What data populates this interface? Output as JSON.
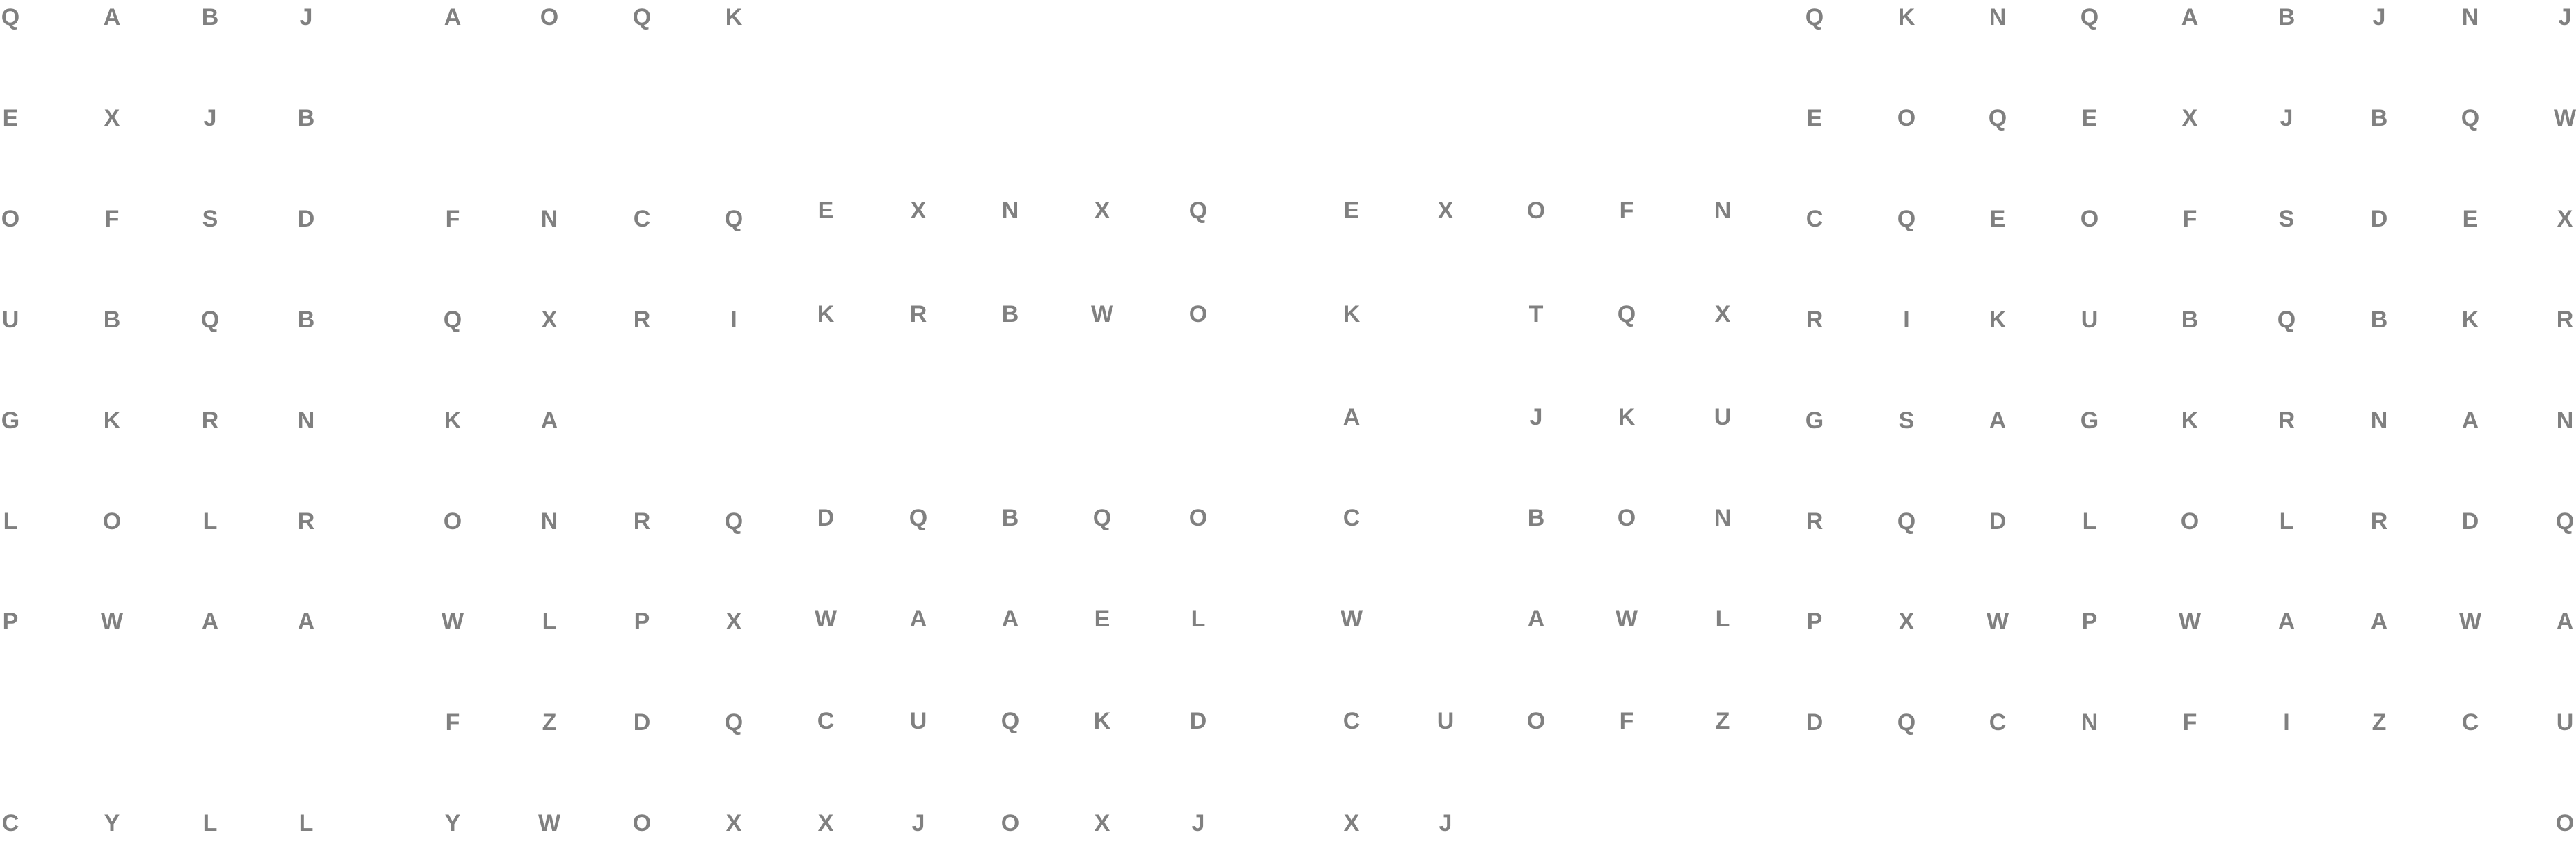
{
  "grids": [
    {
      "name": "block-a",
      "faint_rows": [
        7
      ],
      "rows": [
        [
          "Q",
          "A",
          "B",
          "J"
        ],
        [
          "E",
          "X",
          "J",
          "B"
        ],
        [
          "O",
          "F",
          "S",
          "D"
        ],
        [
          "U",
          "B",
          "Q",
          "B"
        ],
        [
          "G",
          "K",
          "R",
          "N"
        ],
        [
          "L",
          "O",
          "L",
          "R"
        ],
        [
          "P",
          "W",
          "A",
          "A"
        ],
        [
          "",
          "",
          "",
          ""
        ],
        [
          "C",
          "Y",
          "L",
          "L"
        ]
      ]
    },
    {
      "name": "block-b",
      "faint_cells": [
        [
          4,
          2
        ],
        [
          4,
          3
        ]
      ],
      "rows": [
        [
          "A",
          "O",
          "Q",
          "K"
        ],
        [
          "",
          "",
          "",
          ""
        ],
        [
          "F",
          "N",
          "C",
          "Q"
        ],
        [
          "Q",
          "X",
          "R",
          "I"
        ],
        [
          "K",
          "A",
          "",
          ""
        ],
        [
          "O",
          "N",
          "R",
          "Q"
        ],
        [
          "W",
          "L",
          "P",
          "X"
        ],
        [
          "F",
          "Z",
          "D",
          "Q"
        ],
        [
          "Y",
          "W",
          "O",
          "X"
        ]
      ]
    },
    {
      "name": "block-c",
      "faint_cells": [
        [
          2,
          3
        ],
        [
          2,
          4
        ]
      ],
      "rows": [
        [
          "E",
          "X",
          "N",
          "X",
          "Q"
        ],
        [
          "K",
          "R",
          "B",
          "W",
          "O"
        ],
        [
          "",
          "",
          "",
          "",
          ""
        ],
        [
          "D",
          "Q",
          "B",
          "Q",
          "O"
        ],
        [
          "W",
          "A",
          "A",
          "E",
          "L"
        ],
        [
          "C",
          "U",
          "Q",
          "K",
          "D"
        ],
        [
          "X",
          "J",
          "O",
          "X",
          "J"
        ]
      ]
    },
    {
      "name": "block-d",
      "rows": [
        [
          "E",
          "X",
          "O",
          "F",
          "N"
        ],
        [
          "K",
          "",
          "T",
          "Q",
          "X"
        ],
        [
          "A",
          "",
          "J",
          "K",
          "U"
        ],
        [
          "C",
          "",
          "B",
          "O",
          "N"
        ],
        [
          "W",
          "",
          "A",
          "W",
          "L"
        ],
        [
          "C",
          "U",
          "O",
          "F",
          "Z"
        ],
        [
          "X",
          "J",
          "",
          "",
          ""
        ]
      ]
    },
    {
      "name": "block-e",
      "faint_cells": [
        [
          8,
          2
        ],
        [
          8,
          7
        ]
      ],
      "rows": [
        [
          "Q",
          "K",
          "N",
          "Q",
          "A",
          "B",
          "J",
          "N",
          "J"
        ],
        [
          "E",
          "O",
          "Q",
          "E",
          "X",
          "J",
          "B",
          "Q",
          "W"
        ],
        [
          "C",
          "Q",
          "E",
          "O",
          "F",
          "S",
          "D",
          "E",
          "X"
        ],
        [
          "R",
          "I",
          "K",
          "U",
          "B",
          "Q",
          "B",
          "K",
          "R"
        ],
        [
          "G",
          "S",
          "A",
          "G",
          "K",
          "R",
          "N",
          "A",
          "N"
        ],
        [
          "R",
          "Q",
          "D",
          "L",
          "O",
          "L",
          "R",
          "D",
          "Q"
        ],
        [
          "P",
          "X",
          "W",
          "P",
          "W",
          "A",
          "A",
          "W",
          "A"
        ],
        [
          "D",
          "Q",
          "C",
          "N",
          "F",
          "I",
          "Z",
          "C",
          "U"
        ],
        [
          "",
          "",
          "",
          "",
          "",
          "",
          "",
          "",
          "O"
        ]
      ]
    }
  ]
}
